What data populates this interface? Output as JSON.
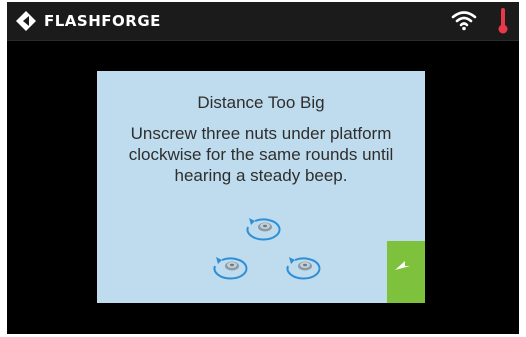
{
  "header": {
    "brand": "FLASHFORGE",
    "logo_icon": "flashforge-logo-icon",
    "wifi_icon": "wifi-icon",
    "temperature_icon": "thermometer-icon"
  },
  "dialog": {
    "title": "Distance Too Big",
    "message": "Unscrew three nuts under platform\nclockwise for the same rounds until\nhearing a steady beep.",
    "illustration_icons": [
      "clockwise-nut-icon",
      "clockwise-nut-icon",
      "clockwise-nut-icon"
    ],
    "back_button_icon": "back-arrow-icon"
  },
  "colors": {
    "screen_bg": "#000000",
    "topbar_bg": "#1b1b1b",
    "dialog_bg": "#bfdcee",
    "accent_green": "#7ec13c",
    "arrow_blue": "#2e8fd6",
    "thermo_red": "#e8384a"
  }
}
